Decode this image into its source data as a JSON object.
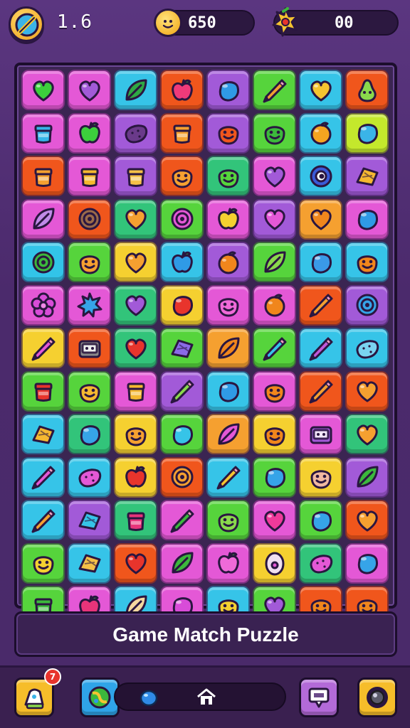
{
  "hud": {
    "level": "1.6",
    "coins": "650",
    "gems": "00"
  },
  "board": {
    "rows": [
      [
        {
          "c": "#e458d6",
          "i": "heart",
          "f": "#3ccf3c"
        },
        {
          "c": "#e458d6",
          "i": "heart",
          "f": "#a25ad8"
        },
        {
          "c": "#36c4e8",
          "i": "leaf",
          "f": "#2fa844"
        },
        {
          "c": "#f0561c",
          "i": "apple",
          "f": "#ef3a7a"
        },
        {
          "c": "#a25ad8",
          "i": "blob",
          "f": "#2f9ae6"
        },
        {
          "c": "#56d43c",
          "i": "pencil",
          "f": "#f0a030"
        },
        {
          "c": "#36c4e8",
          "i": "heart",
          "f": "#f5c430"
        },
        {
          "c": "#f0561c",
          "i": "pear",
          "f": "#8ad84c"
        }
      ],
      [
        {
          "c": "#e458d6",
          "i": "jar",
          "f": "#36b4e8"
        },
        {
          "c": "#e458d6",
          "i": "apple",
          "f": "#3ccf3c"
        },
        {
          "c": "#a25ad8",
          "i": "potato",
          "f": "#6a3a8a"
        },
        {
          "c": "#f0561c",
          "i": "jar",
          "f": "#f5a030"
        },
        {
          "c": "#a25ad8",
          "i": "face",
          "f": "#f0561c"
        },
        {
          "c": "#56d43c",
          "i": "face",
          "f": "#3cb83c"
        },
        {
          "c": "#36c4e8",
          "i": "orange",
          "f": "#f5a420"
        },
        {
          "c": "#c4e82c",
          "i": "blob",
          "f": "#3ab4e8"
        }
      ],
      [
        {
          "c": "#f0561c",
          "i": "jar",
          "f": "#f5a030"
        },
        {
          "c": "#e458d6",
          "i": "jar",
          "f": "#f5b830"
        },
        {
          "c": "#a25ad8",
          "i": "jar",
          "f": "#f5c048"
        },
        {
          "c": "#f0561c",
          "i": "face",
          "f": "#f5a030"
        },
        {
          "c": "#32c47a",
          "i": "face",
          "f": "#56d43c"
        },
        {
          "c": "#e458d6",
          "i": "heart",
          "f": "#a25ad8"
        },
        {
          "c": "#36c4e8",
          "i": "eye",
          "f": "#3a5ad8"
        },
        {
          "c": "#a25ad8",
          "i": "chip",
          "f": "#f5b830"
        }
      ],
      [
        {
          "c": "#e458d6",
          "i": "leaf",
          "f": "#c08ae8"
        },
        {
          "c": "#f0561c",
          "i": "ring",
          "f": "#9a6a4a"
        },
        {
          "c": "#32c47a",
          "i": "heart",
          "f": "#f5a030"
        },
        {
          "c": "#56d43c",
          "i": "ring",
          "f": "#e458d6"
        },
        {
          "c": "#e458d6",
          "i": "apple",
          "f": "#f5d030"
        },
        {
          "c": "#a25ad8",
          "i": "heart",
          "f": "#e458d6"
        },
        {
          "c": "#f5a030",
          "i": "heart",
          "f": "#f0861c"
        },
        {
          "c": "#e458d6",
          "i": "blob",
          "f": "#2f9ae6"
        }
      ],
      [
        {
          "c": "#32c4e8",
          "i": "ring",
          "f": "#3cb83c"
        },
        {
          "c": "#56d43c",
          "i": "face",
          "f": "#f5a030"
        },
        {
          "c": "#f5d030",
          "i": "heart",
          "f": "#f5a030"
        },
        {
          "c": "#36c4e8",
          "i": "apple",
          "f": "#2f9ae6"
        },
        {
          "c": "#a25ad8",
          "i": "orange",
          "f": "#f0861c"
        },
        {
          "c": "#56d43c",
          "i": "leaf",
          "f": "#8ad84c"
        },
        {
          "c": "#36c4e8",
          "i": "blob",
          "f": "#3a9ae8"
        },
        {
          "c": "#36c4e8",
          "i": "face",
          "f": "#f0861c"
        }
      ],
      [
        {
          "c": "#e458d6",
          "i": "flower",
          "f": "#d84cd8"
        },
        {
          "c": "#e458d6",
          "i": "star",
          "f": "#36a4e8"
        },
        {
          "c": "#32c47a",
          "i": "heart",
          "f": "#a25ad8"
        },
        {
          "c": "#f5d030",
          "i": "blob",
          "f": "#e8342c"
        },
        {
          "c": "#e458d6",
          "i": "face",
          "f": "#ef6ad8"
        },
        {
          "c": "#e458d6",
          "i": "orange",
          "f": "#f0861c"
        },
        {
          "c": "#f0561c",
          "i": "pencil",
          "f": "#f5a030"
        },
        {
          "c": "#a25ad8",
          "i": "ring",
          "f": "#36a4e8"
        }
      ],
      [
        {
          "c": "#f5d030",
          "i": "pencil",
          "f": "#e458d6"
        },
        {
          "c": "#f0561c",
          "i": "tv",
          "f": "#8a8a8a"
        },
        {
          "c": "#32c47a",
          "i": "heart",
          "f": "#e8342c"
        },
        {
          "c": "#56d43c",
          "i": "chip",
          "f": "#8a6ae8"
        },
        {
          "c": "#f5a030",
          "i": "leaf",
          "f": "#f0861c"
        },
        {
          "c": "#56d43c",
          "i": "pencil",
          "f": "#36c4e8"
        },
        {
          "c": "#36c4e8",
          "i": "pencil",
          "f": "#c058d8"
        },
        {
          "c": "#36c4e8",
          "i": "potato",
          "f": "#7ad4f0"
        }
      ],
      [
        {
          "c": "#56d43c",
          "i": "jar",
          "f": "#e8342c"
        },
        {
          "c": "#56d43c",
          "i": "face",
          "f": "#f5b830"
        },
        {
          "c": "#e458d6",
          "i": "jar",
          "f": "#f5b830"
        },
        {
          "c": "#a25ad8",
          "i": "pencil",
          "f": "#8ad84c"
        },
        {
          "c": "#36c4e8",
          "i": "blob",
          "f": "#2f9ae6"
        },
        {
          "c": "#e458d6",
          "i": "face",
          "f": "#f0861c"
        },
        {
          "c": "#f0561c",
          "i": "pencil",
          "f": "#f5a030"
        },
        {
          "c": "#f0561c",
          "i": "heart",
          "f": "#f5a030"
        }
      ],
      [
        {
          "c": "#36c4e8",
          "i": "chip",
          "f": "#f5b830"
        },
        {
          "c": "#32c47a",
          "i": "blob",
          "f": "#36a4e8"
        },
        {
          "c": "#f5d030",
          "i": "face",
          "f": "#f5a030"
        },
        {
          "c": "#56d43c",
          "i": "blob",
          "f": "#36c4e8"
        },
        {
          "c": "#f5a030",
          "i": "leaf",
          "f": "#e458d6"
        },
        {
          "c": "#f5d030",
          "i": "face",
          "f": "#f0861c"
        },
        {
          "c": "#e458d6",
          "i": "tv",
          "f": "#a25ad8"
        },
        {
          "c": "#32c47a",
          "i": "heart",
          "f": "#f5a030"
        }
      ],
      [
        {
          "c": "#36c4e8",
          "i": "pencil",
          "f": "#e458d6"
        },
        {
          "c": "#36c4e8",
          "i": "potato",
          "f": "#e458d6"
        },
        {
          "c": "#f5d030",
          "i": "apple",
          "f": "#e8342c"
        },
        {
          "c": "#f0561c",
          "i": "ring",
          "f": "#f5a030"
        },
        {
          "c": "#36c4e8",
          "i": "pencil",
          "f": "#f5c430"
        },
        {
          "c": "#56d43c",
          "i": "blob",
          "f": "#36a4e8"
        },
        {
          "c": "#f5d030",
          "i": "face",
          "f": "#f0b8a0"
        },
        {
          "c": "#a25ad8",
          "i": "leaf",
          "f": "#3cb83c"
        }
      ],
      [
        {
          "c": "#36c4e8",
          "i": "pencil",
          "f": "#f5a030"
        },
        {
          "c": "#a25ad8",
          "i": "chip",
          "f": "#36c4e8"
        },
        {
          "c": "#32c47a",
          "i": "jar",
          "f": "#e8347a"
        },
        {
          "c": "#e458d6",
          "i": "pencil",
          "f": "#3cb83c"
        },
        {
          "c": "#56d43c",
          "i": "face",
          "f": "#8ad84c"
        },
        {
          "c": "#e458d6",
          "i": "heart",
          "f": "#ef3a9a"
        },
        {
          "c": "#56d43c",
          "i": "blob",
          "f": "#36a4e8"
        },
        {
          "c": "#f0561c",
          "i": "heart",
          "f": "#f5a030"
        }
      ],
      [
        {
          "c": "#56d43c",
          "i": "face",
          "f": "#f5d030"
        },
        {
          "c": "#36c4e8",
          "i": "chip",
          "f": "#f5c048"
        },
        {
          "c": "#f0561c",
          "i": "heart",
          "f": "#e8342c"
        },
        {
          "c": "#e458d6",
          "i": "leaf",
          "f": "#3cb83c"
        },
        {
          "c": "#e458d6",
          "i": "apple",
          "f": "#ef6ad8"
        },
        {
          "c": "#f5d030",
          "i": "egg",
          "f": "#f0e0f0"
        },
        {
          "c": "#32c47a",
          "i": "potato",
          "f": "#e458d6"
        },
        {
          "c": "#e458d6",
          "i": "blob",
          "f": "#36a4e8"
        }
      ],
      [
        {
          "c": "#56d43c",
          "i": "jar",
          "f": "#3cb83c"
        },
        {
          "c": "#e458d6",
          "i": "apple",
          "f": "#e8347a"
        },
        {
          "c": "#36c4e8",
          "i": "leaf",
          "f": "#f5d8a0"
        },
        {
          "c": "#e458d6",
          "i": "blob",
          "f": "#d84cd8"
        },
        {
          "c": "#36c4e8",
          "i": "face",
          "f": "#f5d030"
        },
        {
          "c": "#56d43c",
          "i": "heart",
          "f": "#a25ad8"
        },
        {
          "c": "#f0561c",
          "i": "face",
          "f": "#f0861c"
        },
        {
          "c": "#f0561c",
          "i": "face",
          "f": "#f0861c"
        }
      ]
    ]
  },
  "title_banner": {
    "text": "Game Match Puzzle"
  },
  "bottom_bar": {
    "hint_badge": "7",
    "level_progress": 0.12
  }
}
